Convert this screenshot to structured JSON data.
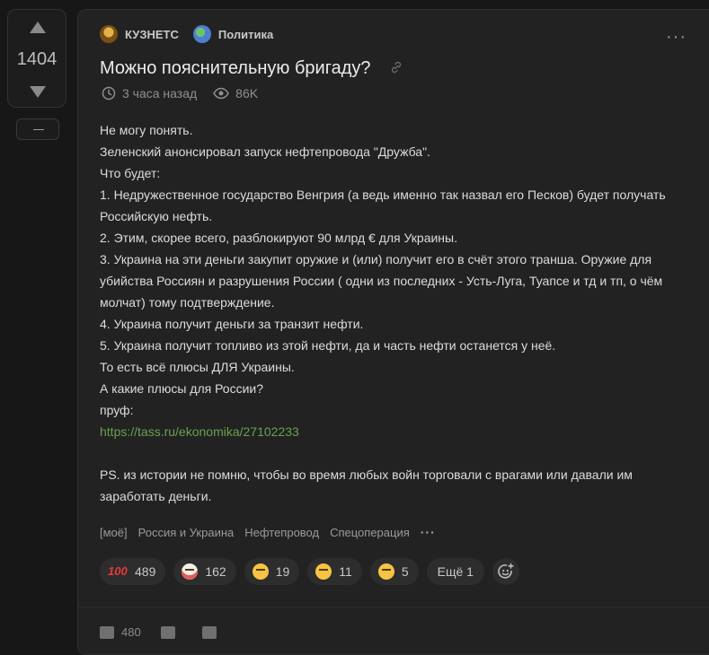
{
  "votes": {
    "count": "1404"
  },
  "post": {
    "author": "КУЗНЕТС",
    "community": "Политика",
    "title": "Можно пояснительную бригаду?",
    "time": "3 часа назад",
    "views": "86K",
    "body": [
      "Не могу понять.",
      "Зеленский анонсировал запуск нефтепровода \"Дружба\".",
      "Что будет:",
      "1. Недружественное государство Венгрия (а ведь именно так назвал его Песков) будет получать Российскую нефть.",
      "2. Этим, скорее всего, разблокируют 90 млрд € для Украины.",
      "3. Украина на эти деньги закупит оружие и (или) получит его в счёт этого транша. Оружие для убийства Россиян и разрушения России ( одни из последних - Усть-Луга, Туапсе и тд и тп, о чём молчат) тому подтверждение.",
      "4. Украина получит деньги за транзит нефти.",
      "5. Украина получит топливо из этой нефти, да и часть нефти останется у неё.",
      "То есть всё плюсы ДЛЯ Украины.",
      "А какие плюсы для России?",
      "пруф:"
    ],
    "link": "https://tass.ru/ekonomika/27102233",
    "ps": "PS. из истории не помню, чтобы во время любых войн торговали с врагами или давали им заработать деньги."
  },
  "tags": [
    "[моё]",
    "Россия и Украина",
    "Нефтепровод",
    "Спецоперация"
  ],
  "reactions": [
    {
      "icon": "hundred-icon",
      "count": "489"
    },
    {
      "icon": "clown-icon",
      "count": "162"
    },
    {
      "icon": "laughing-face-icon",
      "count": "19"
    },
    {
      "icon": "thinking-face-icon",
      "count": "11"
    },
    {
      "icon": "sad-face-icon",
      "count": "5"
    }
  ],
  "reactions_more": "Ещё 1",
  "footer": {
    "comments": "480"
  },
  "colors": {
    "background": "#171717",
    "card": "#222222",
    "link": "#6aa14d"
  }
}
